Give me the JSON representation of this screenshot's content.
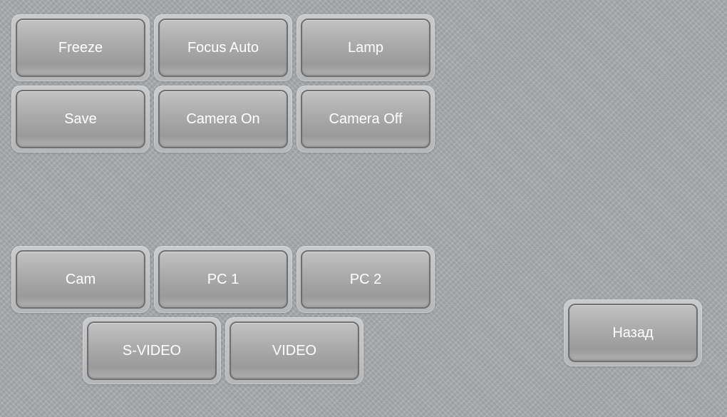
{
  "buttons": {
    "freeze": "Freeze",
    "focus_auto": "Focus Auto",
    "lamp": "Lamp",
    "save": "Save",
    "camera_on": "Camera On",
    "camera_off": "Camera Off",
    "cam": "Cam",
    "pc1": "PC 1",
    "pc2": "PC 2",
    "svideo": "S-VIDEO",
    "video": "VIDEO",
    "back": "Назад"
  }
}
